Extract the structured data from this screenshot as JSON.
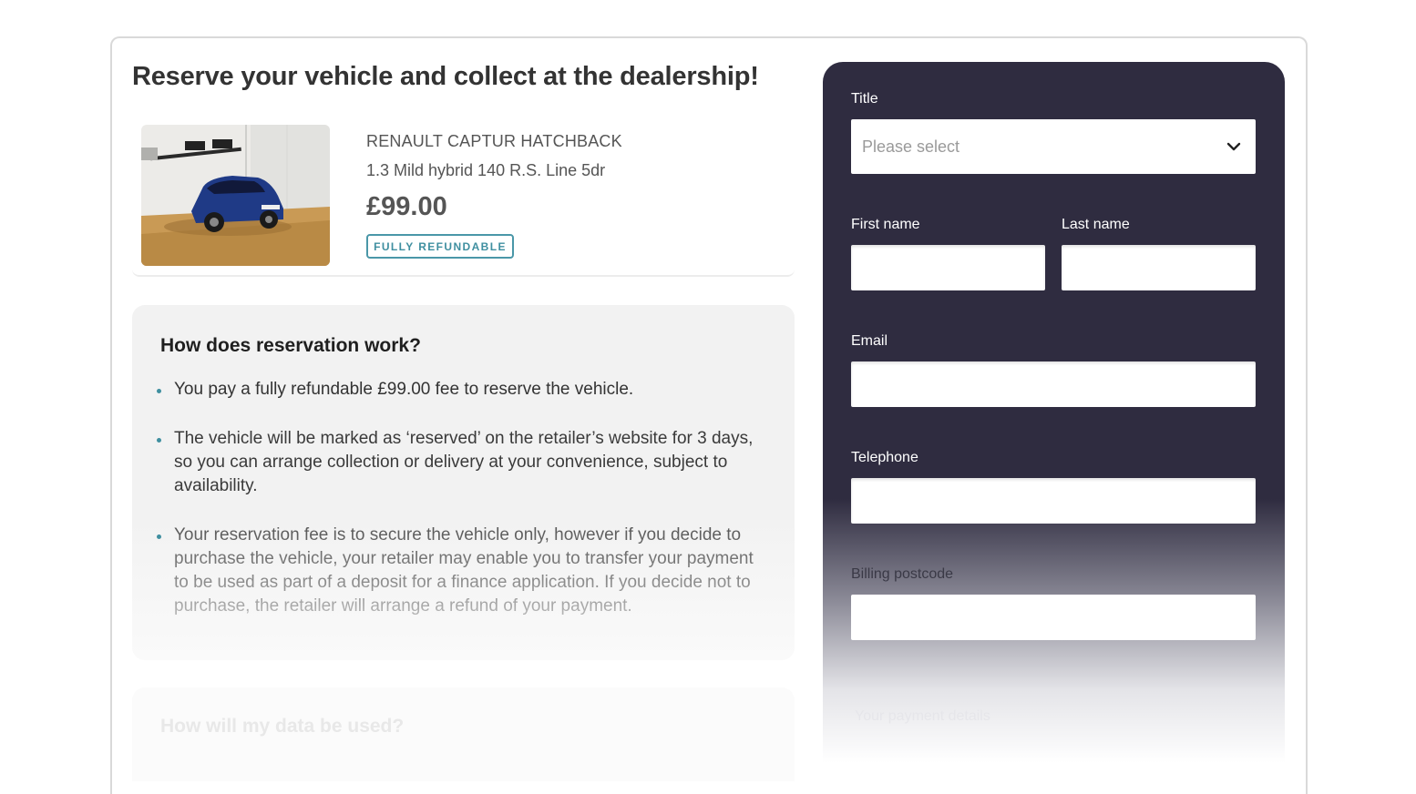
{
  "page": {
    "heading": "Reserve your vehicle and collect at the dealership!"
  },
  "vehicle": {
    "name": "RENAULT CAPTUR HATCHBACK",
    "variant": "1.3 Mild hybrid 140 R.S. Line 5dr",
    "price": "£99.00",
    "badge": "FULLY REFUNDABLE",
    "photo_icon": "car-photo"
  },
  "info": {
    "title": "How does reservation work?",
    "bullets": [
      "You pay a fully refundable £99.00 fee to reserve the vehicle.",
      "The vehicle will be marked as ‘reserved’ on the retailer’s website for 3 days, so you can arrange collection or delivery at your convenience, subject to availability.",
      "Your reservation fee is to secure the vehicle only, however if you decide to purchase the vehicle, your retailer may enable you to transfer your payment to be used as part of a deposit for a finance application. If you decide not to purchase, the retailer will arrange a refund of your payment."
    ]
  },
  "info2": {
    "title": "How will my data be used?"
  },
  "form": {
    "title_label": "Title",
    "title_value": "Please select",
    "first_name_label": "First name",
    "last_name_label": "Last name",
    "email_label": "Email",
    "telephone_label": "Telephone",
    "postcode_label": "Billing postcode",
    "payment_label": "Your payment details"
  },
  "colors": {
    "panel": "#2f2c40",
    "accent": "#3f8fa0"
  }
}
